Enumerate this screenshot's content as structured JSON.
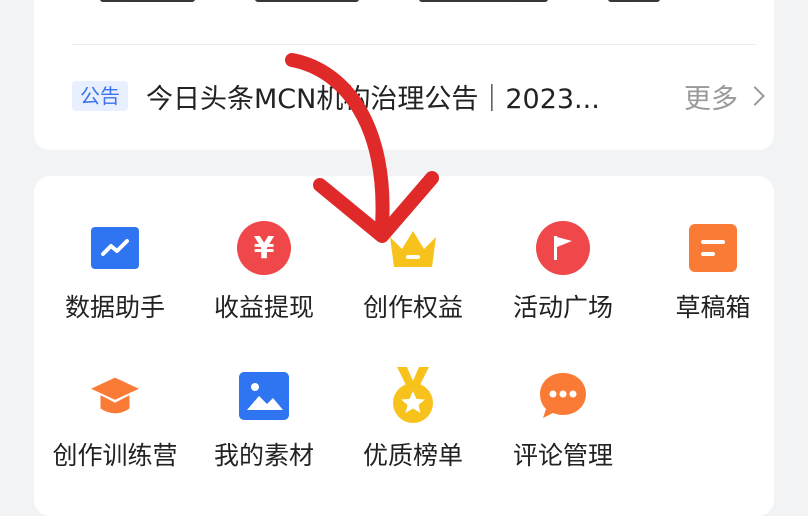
{
  "announcement": {
    "badge": "公告",
    "text": "今日头条MCN机构治理公告｜2023...",
    "more": "更多"
  },
  "tools": [
    {
      "label": "数据助手",
      "icon": "chart-icon"
    },
    {
      "label": "收益提现",
      "icon": "yen-icon"
    },
    {
      "label": "创作权益",
      "icon": "crown-icon"
    },
    {
      "label": "活动广场",
      "icon": "flag-icon"
    },
    {
      "label": "草稿箱",
      "icon": "draft-icon"
    },
    {
      "label": "创作训练营",
      "icon": "graduation-cap-icon"
    },
    {
      "label": "我的素材",
      "icon": "image-icon"
    },
    {
      "label": "优质榜单",
      "icon": "medal-icon"
    },
    {
      "label": "评论管理",
      "icon": "comment-icon"
    }
  ],
  "colors": {
    "blue": "#2f74f0",
    "red": "#f0474a",
    "yellow": "#f7c21b",
    "orange": "#f97b36",
    "arrow": "#e02a2a"
  },
  "yen_glyph": "¥"
}
